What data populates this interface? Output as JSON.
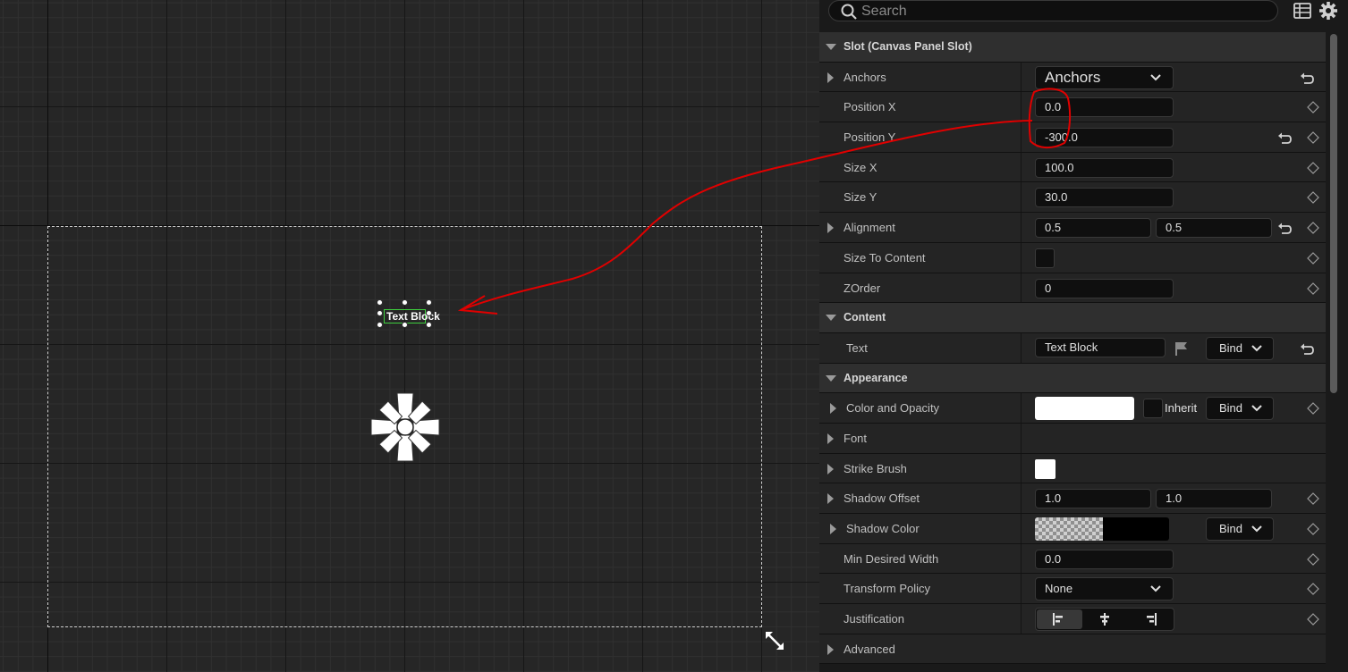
{
  "canvas": {
    "widget_label": "Text Block"
  },
  "panel": {
    "search_placeholder": "Search",
    "sections": {
      "slot": "Slot (Canvas Panel Slot)",
      "content": "Content",
      "appearance": "Appearance"
    },
    "props": {
      "anchors": {
        "label": "Anchors",
        "value": "Anchors"
      },
      "position_x": {
        "label": "Position X",
        "value": "0.0"
      },
      "position_y": {
        "label": "Position Y",
        "value": "-300.0"
      },
      "size_x": {
        "label": "Size X",
        "value": "100.0"
      },
      "size_y": {
        "label": "Size Y",
        "value": "30.0"
      },
      "alignment": {
        "label": "Alignment",
        "x": "0.5",
        "y": "0.5"
      },
      "size_to_content": {
        "label": "Size To Content"
      },
      "zorder": {
        "label": "ZOrder",
        "value": "0"
      },
      "text": {
        "label": "Text",
        "value": "Text Block",
        "bind": "Bind"
      },
      "color_opacity": {
        "label": "Color and Opacity",
        "inherit": "Inherit",
        "bind": "Bind",
        "color": "#ffffff"
      },
      "font": {
        "label": "Font"
      },
      "strike_brush": {
        "label": "Strike Brush",
        "color": "#ffffff"
      },
      "shadow_offset": {
        "label": "Shadow Offset",
        "x": "1.0",
        "y": "1.0"
      },
      "shadow_color": {
        "label": "Shadow Color",
        "bind": "Bind",
        "color": "#000000"
      },
      "min_desired_width": {
        "label": "Min Desired Width",
        "value": "0.0"
      },
      "transform_policy": {
        "label": "Transform Policy",
        "value": "None"
      },
      "justification": {
        "label": "Justification"
      },
      "advanced": {
        "label": "Advanced"
      }
    }
  },
  "colors": {
    "selection": "#3ecf3e",
    "annotation": "#e00000"
  }
}
